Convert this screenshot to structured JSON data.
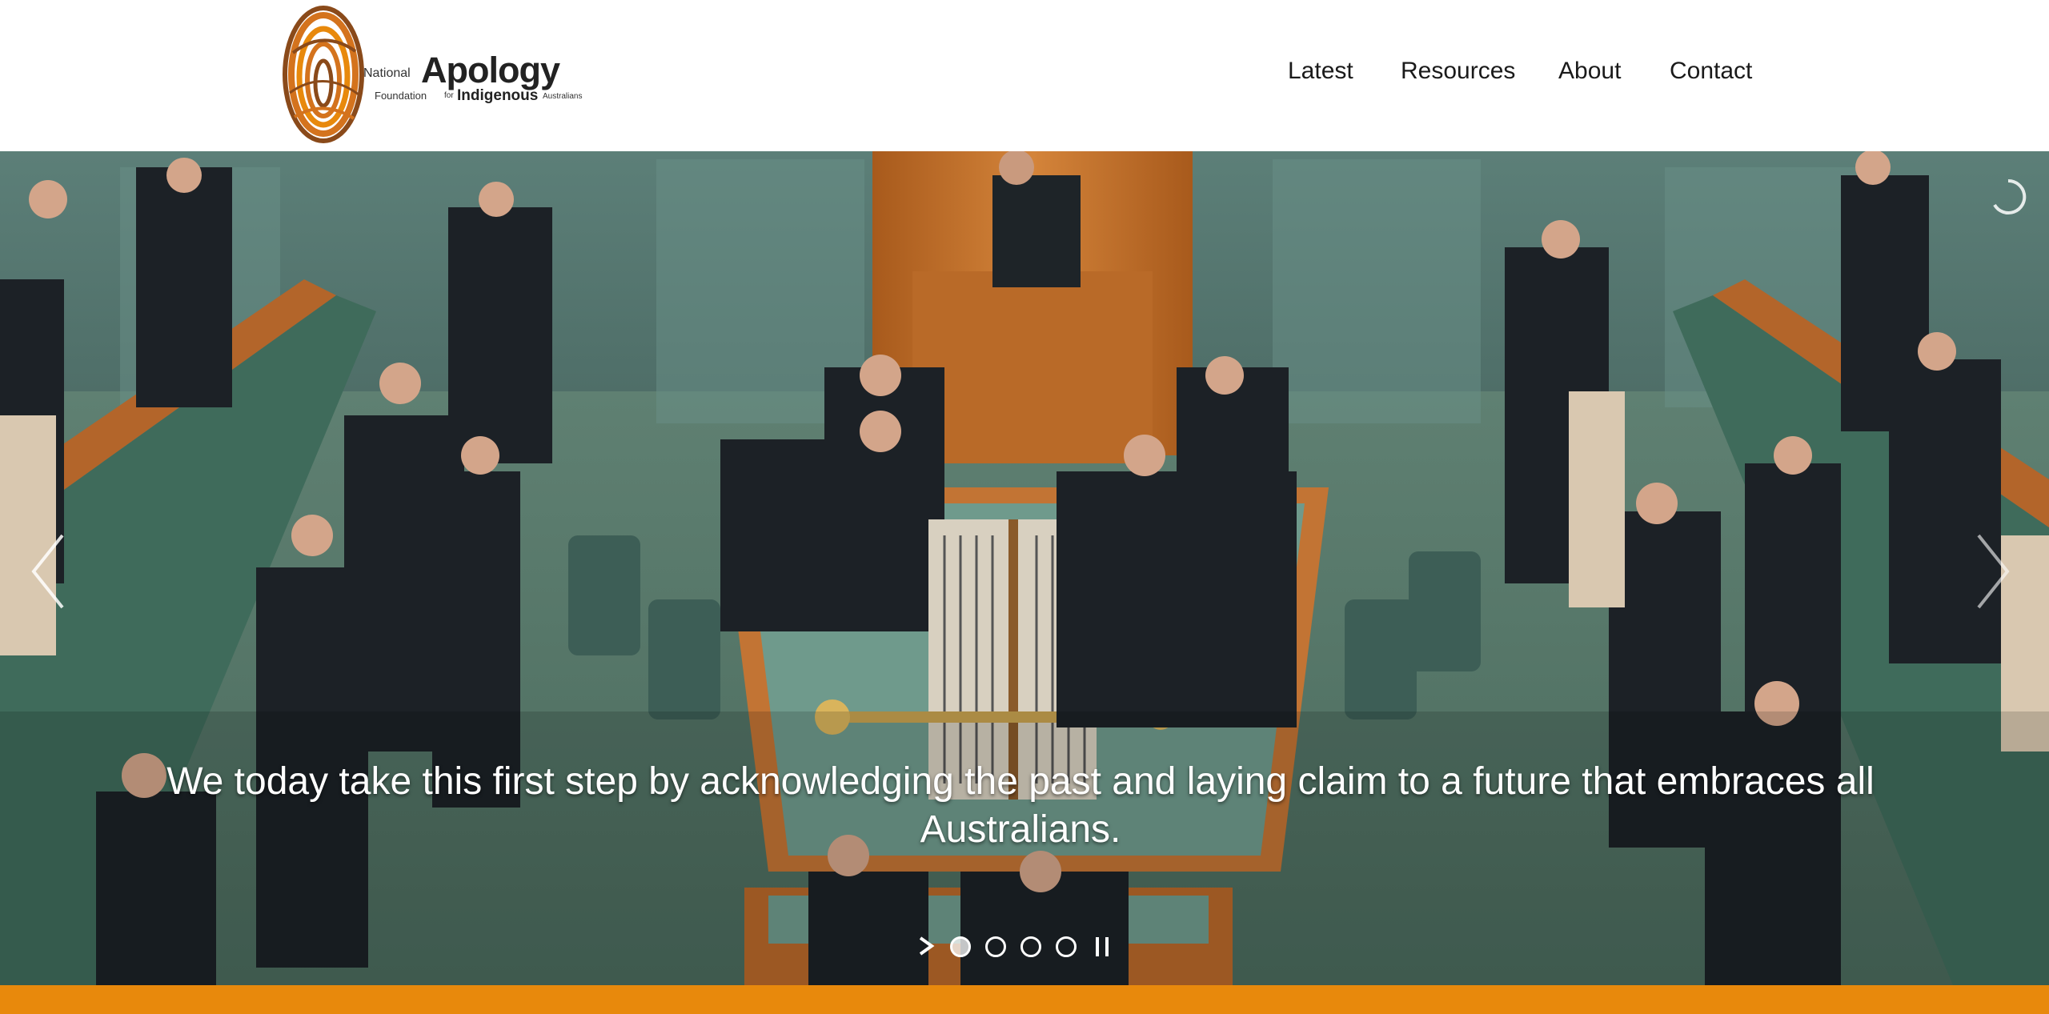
{
  "logo": {
    "national": "National",
    "apology": "Apology",
    "foundation": "Foundation",
    "for": "for",
    "indigenous": "Indigenous",
    "australians": "Australians",
    "mark_icon": "fingerprint-logo-icon"
  },
  "nav": {
    "items": [
      {
        "label": "Latest"
      },
      {
        "label": "Resources"
      },
      {
        "label": "About"
      },
      {
        "label": "Contact"
      }
    ]
  },
  "slider": {
    "caption": "We today take this first step by acknowledging the past and laying claim to a future that embraces all Australians.",
    "slide_count": 4,
    "active_slide": 1,
    "controls": {
      "play_icon": "play-icon",
      "pause_icon": "pause-icon",
      "prev_icon": "chevron-left-icon",
      "next_icon": "chevron-right-icon",
      "loading_icon": "loading-spinner-icon"
    }
  },
  "colors": {
    "accent_orange": "#e8890c",
    "logo_orange": "#d4731d",
    "logo_brown": "#8a4a1a",
    "text_dark": "#1a1a1a"
  }
}
